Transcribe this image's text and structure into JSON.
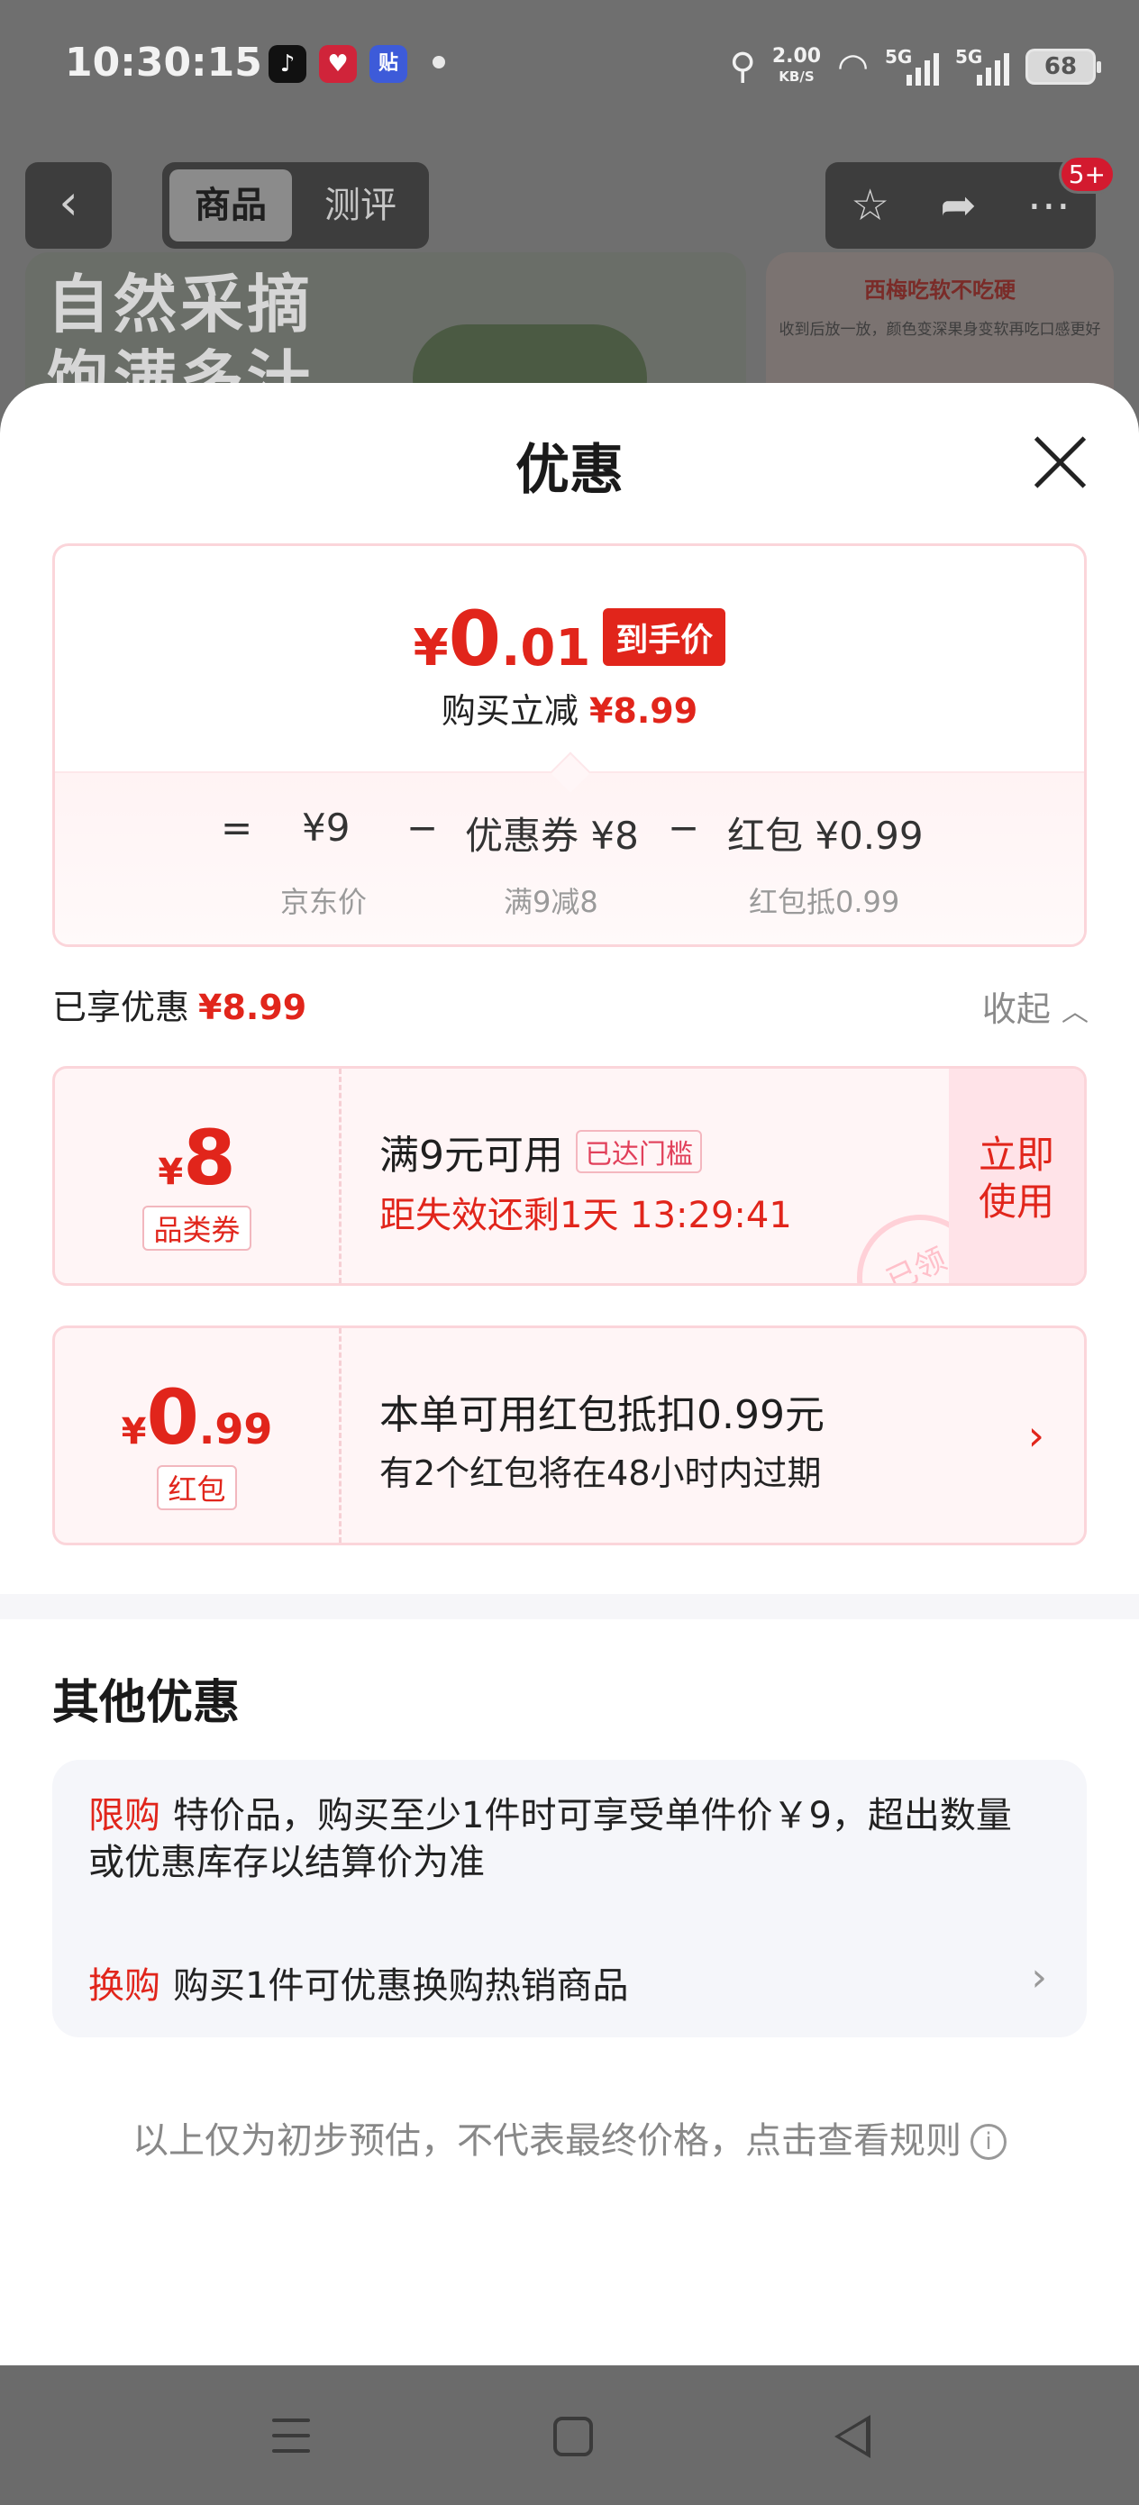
{
  "status_bar": {
    "time": "10:30:15",
    "speed_value": "2.00",
    "speed_unit": "KB/S",
    "net1": "5G",
    "net2": "5G",
    "battery": "68"
  },
  "top_nav": {
    "tab_goods": "商品",
    "tab_review": "测评",
    "badge": "5+"
  },
  "background": {
    "banner_line1": "自然采摘",
    "banner_line2": "饱满多汁",
    "side_title": "西梅吃软不吃硬",
    "side_sub": "收到后放一放，颜色变深果身变软再吃口感更好"
  },
  "sheet": {
    "title": "优惠",
    "price": {
      "yen": "¥",
      "int": "0",
      "dec": ".01",
      "tag": "到手价",
      "reduce_label": "购买立减",
      "reduce_value": "¥8.99"
    },
    "formula": {
      "eq": "=",
      "jd_price": "¥9",
      "minus1": "−",
      "coupon": "优惠券 ¥8",
      "minus2": "−",
      "redpack": "红包 ¥0.99",
      "jd_price_label": "京东价",
      "coupon_label": "满9减8",
      "redpack_label": "红包抵0.99"
    },
    "enjoyed_label": "已享优惠",
    "enjoyed_value": "¥8.99",
    "collapse_label": "收起",
    "coupon1": {
      "yen": "¥",
      "amount": "8",
      "type": "品类券",
      "title": "满9元可用",
      "threshold": "已达门槛",
      "countdown": "距失效还剩1天 13:29:41",
      "action_line1": "立即",
      "action_line2": "使用",
      "stamp": "已领"
    },
    "coupon2": {
      "yen": "¥",
      "amount": "0",
      "decimal": ".99",
      "type": "红包",
      "title": "本单可用红包抵扣0.99元",
      "subtitle": "有2个红包将在48小时内过期"
    },
    "other_title": "其他优惠",
    "other": {
      "limit_tag": "限购",
      "limit_text": "特价品，购买至少1件时可享受单件价￥9，超出数量或优惠库存以结算价为准",
      "swap_tag": "换购",
      "swap_text": "购买1件可优惠换购热销商品"
    },
    "note": "以上仅为初步预估，不代表最终价格，点击查看规则"
  },
  "colors": {
    "accent": "#e1251b",
    "coupon_bg": "#fff5f6",
    "coupon_border": "#fbd5da"
  }
}
